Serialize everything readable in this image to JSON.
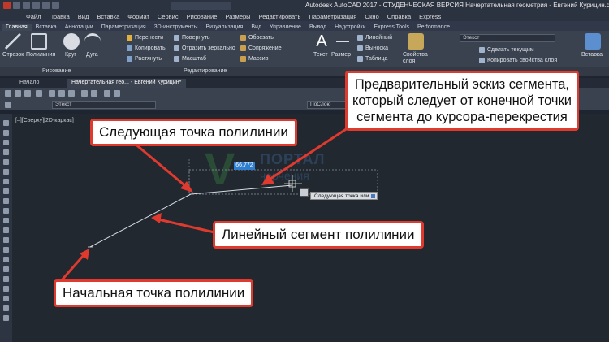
{
  "window": {
    "title": "Autodesk AutoCAD 2017 - СТУДЕНЧЕСКАЯ ВЕРСИЯ    Начертательная геометрия - Евгений Курицин.dwg"
  },
  "menubar": [
    "Файл",
    "Правка",
    "Вид",
    "Вставка",
    "Формат",
    "Сервис",
    "Рисование",
    "Размеры",
    "Редактировать",
    "Параметризация",
    "Окно",
    "Справка",
    "Express"
  ],
  "ribbon_tabs": [
    {
      "label": "Главная",
      "active": true
    },
    {
      "label": "Вставка",
      "active": false
    },
    {
      "label": "Аннотации",
      "active": false
    },
    {
      "label": "Параметризация",
      "active": false
    },
    {
      "label": "3D-инструменты",
      "active": false
    },
    {
      "label": "Визуализация",
      "active": false
    },
    {
      "label": "Вид",
      "active": false
    },
    {
      "label": "Управление",
      "active": false
    },
    {
      "label": "Вывод",
      "active": false
    },
    {
      "label": "Надстройки",
      "active": false
    },
    {
      "label": "Express Tools",
      "active": false
    },
    {
      "label": "Performance",
      "active": false
    }
  ],
  "ribbon": {
    "draw_tools": [
      "Отрезок",
      "Полилиния",
      "Круг",
      "Дуга"
    ],
    "modify_col1": [
      "Перенести",
      "Копировать",
      "Растянуть"
    ],
    "modify_col2": [
      "Повернуть",
      "Отразить зеркально",
      "Масштаб"
    ],
    "modify_col3": [
      "Обрезать",
      "Сопряжение",
      "Массив"
    ],
    "annot_text": "Текст",
    "annot_size": "Размер",
    "annot_items": [
      "Линейный",
      "Выноска",
      "Таблица"
    ],
    "layer_props": "Свойства слоя",
    "layer_combo": "Этекст",
    "layer_items": [
      "Сделать текущим",
      "Копировать свойства слоя"
    ],
    "insert": "Вставка",
    "panels": {
      "draw": "Рисование",
      "modify": "Редактирование"
    }
  },
  "doc_tabs": [
    {
      "label": "Начало",
      "active": false
    },
    {
      "label": "Начертательная гео... - Евгений Курицин*",
      "active": true
    }
  ],
  "toolbar2": {
    "style_combo": "Этекст",
    "bylayer_combo": "ПоСлою"
  },
  "viewport": {
    "label": "[–][Сверху][2D-каркас]"
  },
  "watermark": {
    "letter": "V",
    "line1": "ПОРТАЛ",
    "line2": "черчения"
  },
  "drawing": {
    "dynamic_input": "66,772",
    "prompt_tip": "Следующая точка или"
  },
  "callouts": {
    "next_point": "Следующая точка полилинии",
    "preview": [
      "Предварительный эскиз сегмента,",
      "который следует от конечной точки",
      "сегмента до курсора-перекрестия"
    ],
    "linear_segment": "Линейный сегмент полилинии",
    "start_point": "Начальная точка полилинии"
  },
  "colors": {
    "callout_border": "#e03a2f",
    "canvas": "#212830",
    "ribbon": "#3a4250",
    "dynamic_input": "#2f7fd0"
  }
}
